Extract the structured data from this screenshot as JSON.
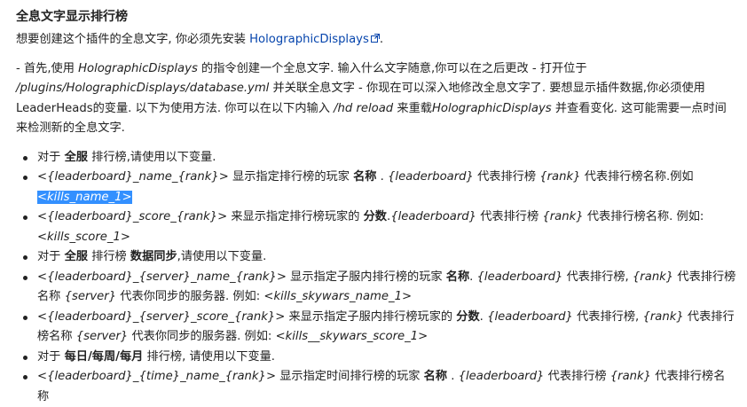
{
  "section": {
    "title": "全息文字显示排行榜",
    "intro_text": "想要创建这个插件的全息文字, 你必须先安装 ",
    "intro_link": "HolographicDisplays",
    "intro_end": "."
  },
  "instructions": {
    "p1": "- 首先,使用 ",
    "p2": "HolographicDisplays",
    "p3": " 的指令创建一个全息文字. 输入什么文字随意,你可以在之后更改 - 打开位于 ",
    "p4": "/plugins/HolographicDisplays/database.yml",
    "p5": " 并关联全息文字 - 你现在可以深入地修改全息文字了. 要想显示插件数据,你必须使用 LeaderHeads的变量. 以下为使用方法. 你可以在以下内输入 ",
    "p6": "/hd reload",
    "p7": " 来重载",
    "p8": "HolographicDisplays",
    "p9": " 并查看变化. 这可能需要一点时间来检测新的全息文字."
  },
  "items": [
    {
      "a": "对于 ",
      "b": "全服",
      "c": " 排行榜,请使用以下变量."
    },
    {
      "a": "<{leaderboard}_name_{rank}>",
      "b": " 显示指定排行榜的玩家 ",
      "c": "名称",
      "d": " . ",
      "e": "{leaderboard}",
      "f": " 代表排行榜 ",
      "g": "{rank}",
      "h": " 代表排行榜名称.例如 ",
      "i": "<kills_name_1>"
    },
    {
      "a": "<{leaderboard}_score_{rank}>",
      "b": " 来显示指定排行榜玩家的 ",
      "c": "分数",
      "d": ".",
      "e": "{leaderboard}",
      "f": " 代表排行榜 ",
      "g": "{rank}",
      "h": " 代表排行榜名称. 例如: ",
      "i": "<kills_score_1>"
    },
    {
      "a": "对于 ",
      "b": "全服",
      "c": " 排行榜 ",
      "d": "数据同步",
      "e": ",请使用以下变量."
    },
    {
      "a": "<{leaderboard}_{server}_name_{rank}>",
      "b": " 显示指定子服内排行榜的玩家 ",
      "c": "名称",
      "d": ". ",
      "e": "{leaderboard}",
      "f": " 代表排行榜, ",
      "g": "{rank}",
      "h": " 代表排行榜名称 ",
      "i": "{server}",
      "j": " 代表你同步的服务器. 例如: ",
      "k": "<kills_skywars_name_1>"
    },
    {
      "a": "<{leaderboard}_{server}_score_{rank}>",
      "b": " 来显示指定子服内排行榜玩家的 ",
      "c": "分数",
      "d": ". ",
      "e": "{leaderboard}",
      "f": " 代表排行榜, ",
      "g": "{rank}",
      "h": " 代表排行榜名称 ",
      "i": "{server}",
      "j": " 代表你同步的服务器. 例如: ",
      "k": "<kills__skywars_score_1>"
    },
    {
      "a": "对于 ",
      "b": "每日/每周/每月",
      "c": " 排行榜, 请使用以下变量."
    },
    {
      "a": "<{leaderboard}_{time}_name_{rank}>",
      "b": " 显示指定时间排行榜的玩家 ",
      "c": "名称",
      "d": " . ",
      "e": "{leaderboard}",
      "f": " 代表排行榜 ",
      "g": "{rank}",
      "h": " 代表排行榜名称"
    }
  ],
  "icons": {
    "external_link": "external-link-icon",
    "bullet": "bullet-dot"
  },
  "colors": {
    "link": "#0645ad",
    "selection": "#3390ff",
    "text": "#222222"
  }
}
